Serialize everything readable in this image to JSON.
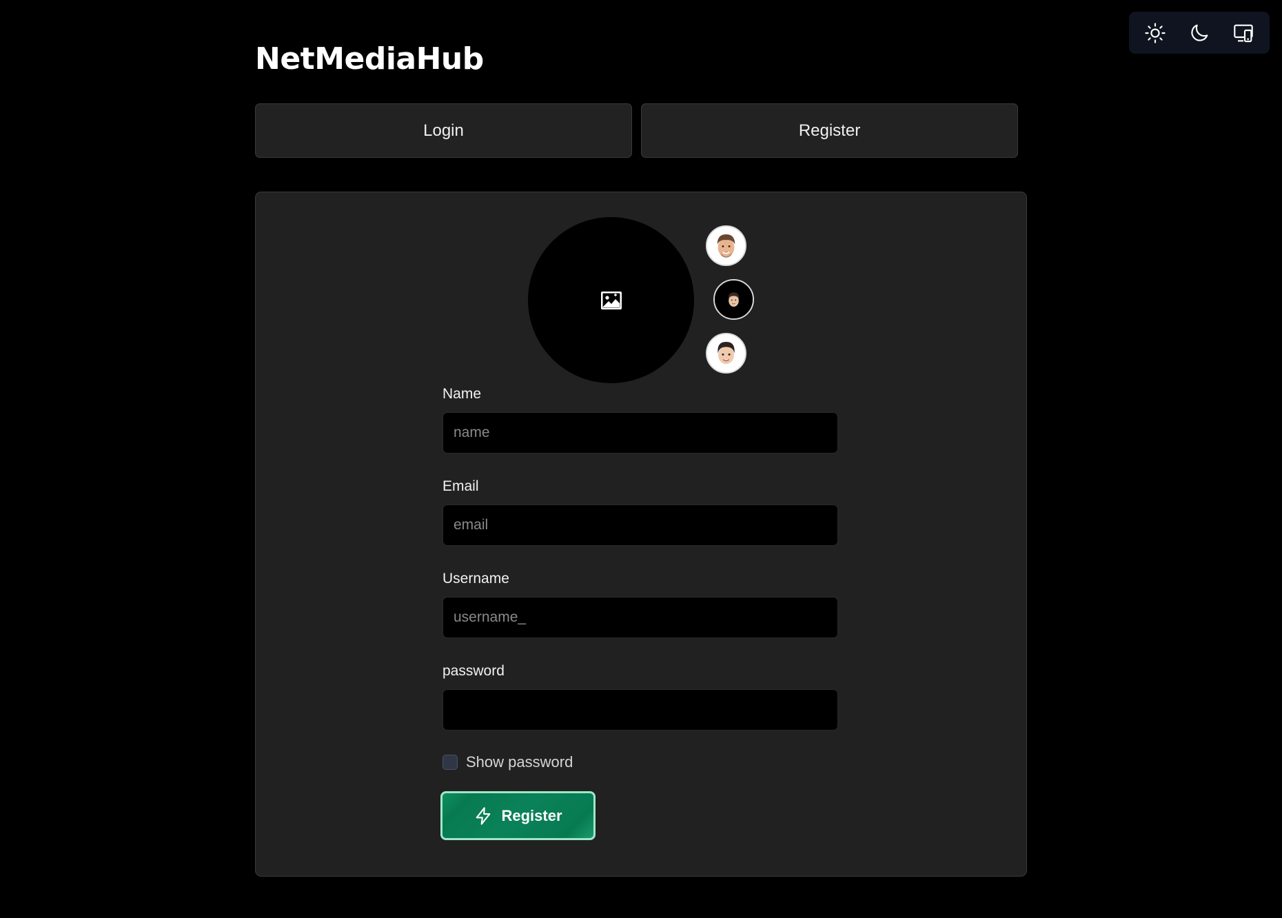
{
  "app": {
    "title": "NetMediaHub"
  },
  "theme_switcher": {
    "options": [
      {
        "icon": "sun-icon",
        "name": "light"
      },
      {
        "icon": "moon-icon",
        "name": "dark"
      },
      {
        "icon": "system-icon",
        "name": "system"
      }
    ]
  },
  "tabs": {
    "login_label": "Login",
    "register_label": "Register"
  },
  "avatar": {
    "main_icon": "image-upload-icon",
    "options": [
      "memoji-avatar-1",
      "memoji-avatar-2",
      "memoji-avatar-3"
    ]
  },
  "form": {
    "name": {
      "label": "Name",
      "placeholder": "name",
      "value": ""
    },
    "email": {
      "label": "Email",
      "placeholder": "email",
      "value": ""
    },
    "username": {
      "label": "Username",
      "placeholder": "username_",
      "value": ""
    },
    "password": {
      "label": "password",
      "placeholder": "",
      "value": ""
    },
    "show_password": {
      "label": "Show password",
      "checked": false
    },
    "submit_label": "Register",
    "submit_icon": "lightning-icon"
  },
  "colors": {
    "background": "#000000",
    "card": "#212121",
    "accent": "#0a8259",
    "accent_border": "#9ee8c9"
  }
}
